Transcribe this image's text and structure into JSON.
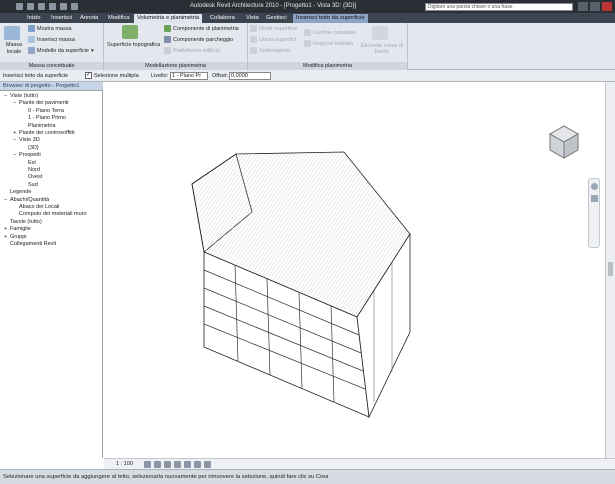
{
  "app": {
    "title": "Autodesk Revit Architecture 2010 - [Progetto1 - Vista 3D: {3D}]"
  },
  "search": {
    "placeholder": "Digitare una parola chiave o una frase"
  },
  "tabs": [
    "Inizio",
    "Inserisci",
    "Annota",
    "Modifica",
    "Volumetria e planimetria",
    "Collabora",
    "Vista",
    "Gestisci",
    "Inserisci tetto da superficie"
  ],
  "ribbon": {
    "massa": {
      "label": "Massa concettuale",
      "big": "Massa locale",
      "items": [
        "Mostra massa",
        "Inserisci massa",
        "Modello da superficie"
      ]
    },
    "modellazione": {
      "label": "Modellazione planimetria",
      "big": "Superficie topografica",
      "items": [
        "Componente di planimetria",
        "Componente parcheggio",
        "Piattaforma edificio"
      ]
    },
    "modifica": {
      "label": "Modifica planimetria",
      "items": [
        "Dividi superficie",
        "Unisci superfici",
        "Sottoregione",
        "Confine catastale",
        "Regione livellata",
        "Etichetta curve di livello"
      ]
    }
  },
  "options": {
    "context": "Inserisci tetto da superficie",
    "checkbox_label": "Selezione multipla",
    "level_label": "Livello:",
    "level_value": "1 - Piano Pr",
    "offset_label": "Offset:",
    "offset_value": "0,0000"
  },
  "browser": {
    "title": "Browser di progetto - Progetto1",
    "nodes": [
      {
        "t": "Viste (tutto)",
        "d": 0,
        "s": "−"
      },
      {
        "t": "Piante dei pavimenti",
        "d": 1,
        "s": "−"
      },
      {
        "t": "0 - Piano Terra",
        "d": 2,
        "s": ""
      },
      {
        "t": "1 - Piano Primo",
        "d": 2,
        "s": ""
      },
      {
        "t": "Planimetria",
        "d": 2,
        "s": ""
      },
      {
        "t": "Piante dei controsoffitti",
        "d": 1,
        "s": "+"
      },
      {
        "t": "Viste 3D",
        "d": 1,
        "s": "−"
      },
      {
        "t": "{3D}",
        "d": 2,
        "s": ""
      },
      {
        "t": "Prospetti",
        "d": 1,
        "s": "−"
      },
      {
        "t": "Est",
        "d": 2,
        "s": ""
      },
      {
        "t": "Nord",
        "d": 2,
        "s": ""
      },
      {
        "t": "Ovest",
        "d": 2,
        "s": ""
      },
      {
        "t": "Sud",
        "d": 2,
        "s": ""
      },
      {
        "t": "Legende",
        "d": 0,
        "s": ""
      },
      {
        "t": "Abachi/Quantità",
        "d": 0,
        "s": "−"
      },
      {
        "t": "Abaco dei Locali",
        "d": 1,
        "s": ""
      },
      {
        "t": "Computo dei materiali muro",
        "d": 1,
        "s": ""
      },
      {
        "t": "Tavole (tutto)",
        "d": 0,
        "s": ""
      },
      {
        "t": "Famiglie",
        "d": 0,
        "s": "+"
      },
      {
        "t": "Gruppi",
        "d": 0,
        "s": "+"
      },
      {
        "t": "Collegamenti Revit",
        "d": 0,
        "s": ""
      }
    ]
  },
  "viewbar": {
    "scale": "1 : 100"
  },
  "status": {
    "text": "Selezionare una superficie da aggiungere al tetto, selezionarla nuovamente per rimuovere la selezione, quindi fare clic su Crea"
  }
}
